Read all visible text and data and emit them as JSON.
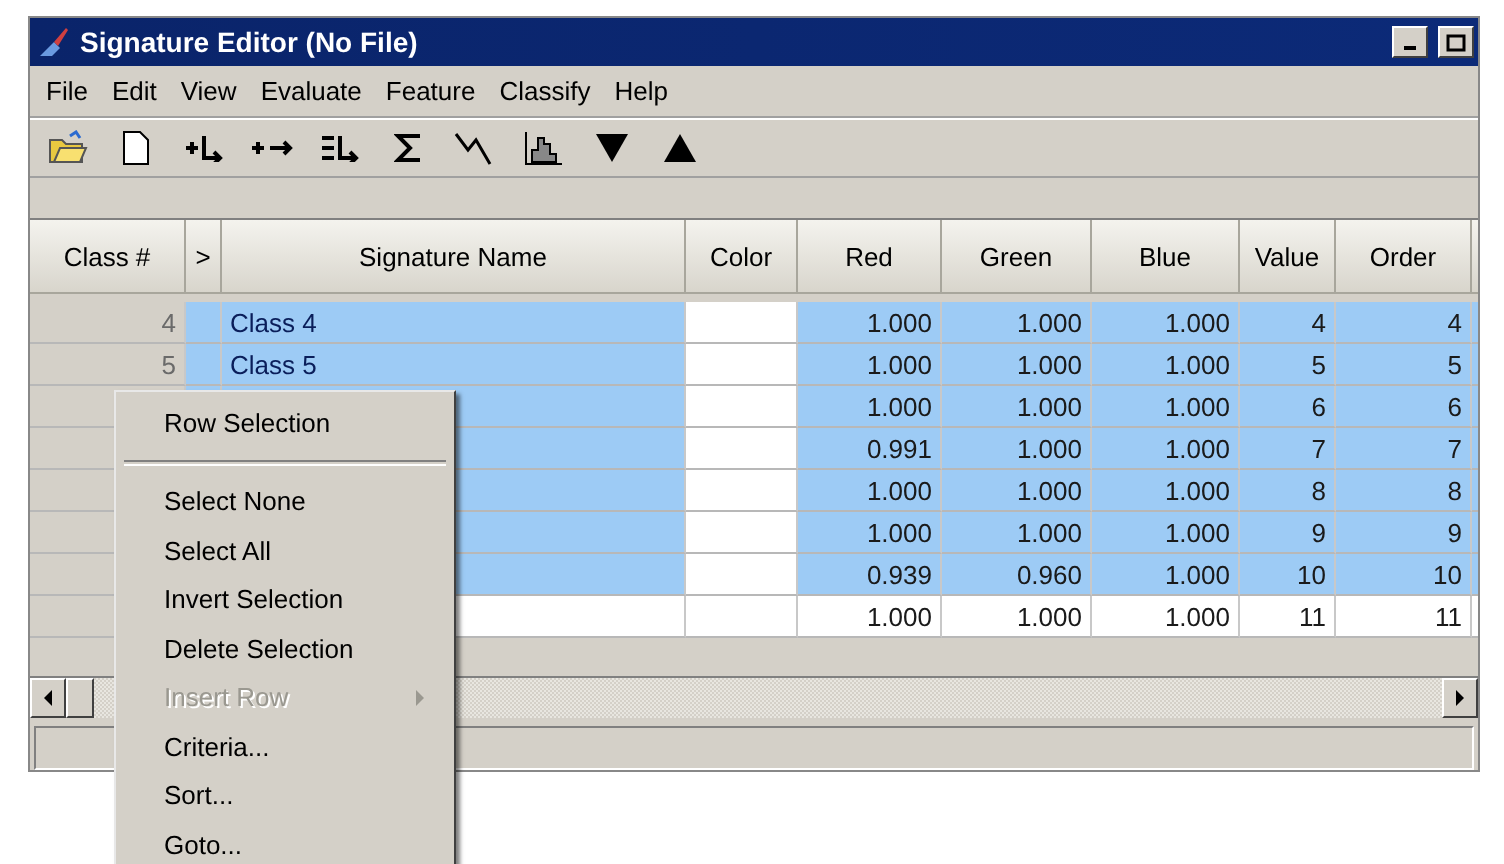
{
  "window": {
    "title": "Signature Editor (No File)"
  },
  "menu_bar": [
    "File",
    "Edit",
    "View",
    "Evaluate",
    "Feature",
    "Classify",
    "Help"
  ],
  "table": {
    "columns": [
      "Class #",
      ">",
      "Signature Name",
      "Color",
      "Red",
      "Green",
      "Blue",
      "Value",
      "Order"
    ],
    "rows": [
      {
        "selected": true,
        "class_no": "4",
        "name": "Class 4",
        "red": "1.000",
        "green": "1.000",
        "blue": "1.000",
        "value": "4",
        "order": "4"
      },
      {
        "selected": true,
        "class_no": "5",
        "name": "Class 5",
        "red": "1.000",
        "green": "1.000",
        "blue": "1.000",
        "value": "5",
        "order": "5"
      },
      {
        "selected": true,
        "red": "1.000",
        "green": "1.000",
        "blue": "1.000",
        "value": "6",
        "order": "6"
      },
      {
        "selected": true,
        "red": "0.991",
        "green": "1.000",
        "blue": "1.000",
        "value": "7",
        "order": "7"
      },
      {
        "selected": true,
        "red": "1.000",
        "green": "1.000",
        "blue": "1.000",
        "value": "8",
        "order": "8"
      },
      {
        "selected": true,
        "red": "1.000",
        "green": "1.000",
        "blue": "1.000",
        "value": "9",
        "order": "9"
      },
      {
        "selected": true,
        "red": "0.939",
        "green": "0.960",
        "blue": "1.000",
        "value": "10",
        "order": "10"
      },
      {
        "selected": false,
        "red": "1.000",
        "green": "1.000",
        "blue": "1.000",
        "value": "11",
        "order": "11"
      }
    ]
  },
  "context_menu": {
    "items": [
      {
        "kind": "item",
        "label": "Row Selection",
        "disabled": false
      },
      {
        "kind": "separator"
      },
      {
        "kind": "item",
        "label": "Select None",
        "disabled": false
      },
      {
        "kind": "item",
        "label": "Select All",
        "disabled": false
      },
      {
        "kind": "item",
        "label": "Invert Selection",
        "disabled": false
      },
      {
        "kind": "item",
        "label": "Delete Selection",
        "disabled": false
      },
      {
        "kind": "submenu",
        "label": "Insert Row",
        "disabled": true
      },
      {
        "kind": "item",
        "label": "Criteria...",
        "disabled": false
      },
      {
        "kind": "item",
        "label": "Sort...",
        "disabled": false
      },
      {
        "kind": "item",
        "label": "Goto...",
        "disabled": false
      }
    ]
  }
}
